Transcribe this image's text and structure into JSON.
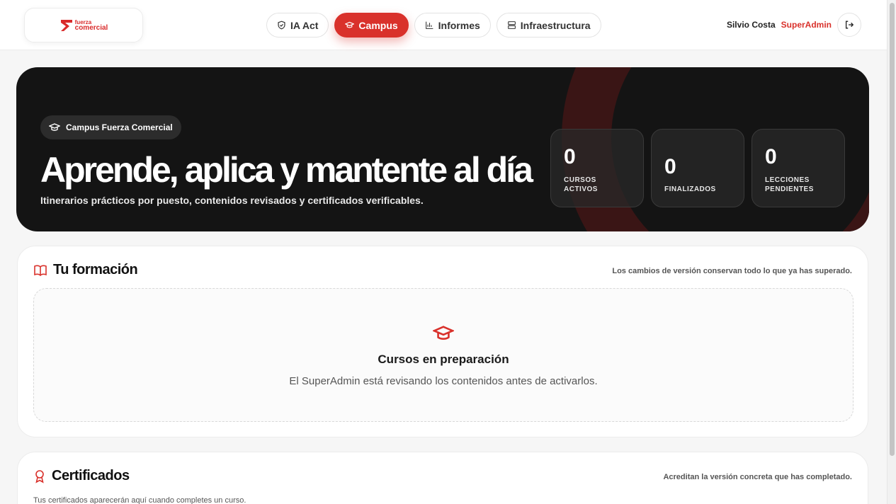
{
  "header": {
    "logo": {
      "line1": "fuerza",
      "line2": "comercial",
      "tagline": ""
    },
    "nav": [
      {
        "label": "IA Act",
        "icon": "shield-icon",
        "active": false
      },
      {
        "label": "Campus",
        "icon": "graduation-cap-icon",
        "active": true
      },
      {
        "label": "Informes",
        "icon": "bar-chart-icon",
        "active": false
      },
      {
        "label": "Infraestructura",
        "icon": "server-icon",
        "active": false
      }
    ],
    "user": {
      "name": "Silvio Costa",
      "role": "SuperAdmin"
    }
  },
  "hero": {
    "badge": "Campus Fuerza Comercial",
    "title": "Aprende, aplica y mantente al día",
    "subtitle": "Itinerarios prácticos por puesto, contenidos revisados y certificados verificables.",
    "stats": [
      {
        "value": "0",
        "label_line1": "CURSOS",
        "label_line2": "ACTIVOS"
      },
      {
        "value": "0",
        "label_line1": "FINALIZADOS",
        "label_line2": ""
      },
      {
        "value": "0",
        "label_line1": "LECCIONES",
        "label_line2": "PENDIENTES"
      }
    ]
  },
  "formacion": {
    "title": "Tu formación",
    "note": "Los cambios de versión conservan todo lo que ya has superado.",
    "empty_title": "Cursos en preparación",
    "empty_text": "El SuperAdmin está revisando los contenidos antes de activarlos."
  },
  "certificados": {
    "title": "Certificados",
    "note": "Acreditan la versión concreta que has completado.",
    "text": "Tus certificados aparecerán aquí cuando completes un curso."
  },
  "colors": {
    "accent": "#d9312b",
    "hero_bg": "#141414",
    "page_bg": "#f6f6f6"
  }
}
